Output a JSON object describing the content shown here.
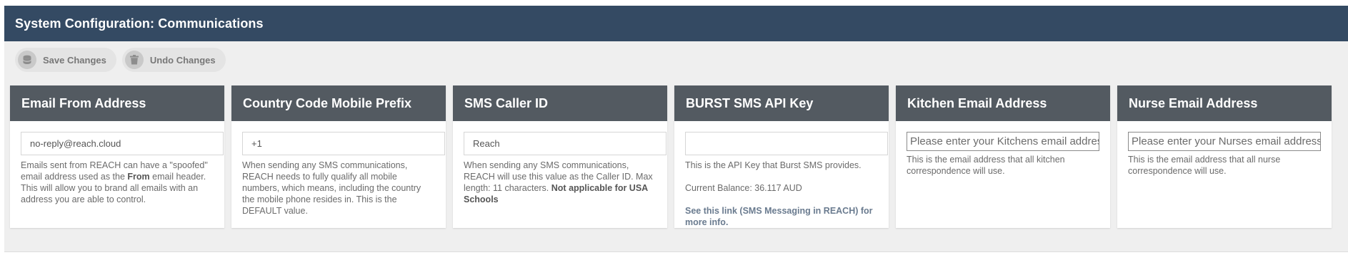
{
  "header": {
    "title": "System Configuration: Communications"
  },
  "toolbar": {
    "save": {
      "label": "Save Changes",
      "icon": "database-icon"
    },
    "undo": {
      "label": "Undo Changes",
      "icon": "trash-icon"
    }
  },
  "colors": {
    "header_bg": "#344a63",
    "card_header_bg": "#535a61",
    "page_bg": "#efefef",
    "link": "#6a7b8f"
  },
  "cards": {
    "email_from": {
      "title": "Email From Address",
      "value": "no-reply@reach.cloud",
      "help_1": "Emails sent from REACH can have a \"spoofed\" email address used as the ",
      "help_bold": "From",
      "help_2": " email header. This will allow you to brand all emails with an address you are able to control."
    },
    "country_code": {
      "title": "Country Code Mobile Prefix",
      "value": "+1",
      "help": "When sending any SMS communications, REACH needs to fully qualify all mobile numbers, which means, including the country the mobile phone resides in. This is the DEFAULT value."
    },
    "sms_caller": {
      "title": "SMS Caller ID",
      "value": "Reach",
      "help_1": "When sending any SMS communications, REACH will use this value as the Caller ID. Max length: 11 characters. ",
      "help_bold": "Not applicable for USA Schools"
    },
    "burst_api": {
      "title": "BURST SMS API Key",
      "value": "",
      "help": "This is the API Key that Burst SMS provides.",
      "balance": "Current Balance: 36.117 AUD",
      "link": "See this link (SMS Messaging in REACH) for more info."
    },
    "kitchen_email": {
      "title": "Kitchen Email Address",
      "placeholder": "Please enter your Kitchens email address",
      "help": "This is the email address that all kitchen correspondence will use."
    },
    "nurse_email": {
      "title": "Nurse Email Address",
      "placeholder": "Please enter your Nurses email address",
      "help": "This is the email address that all nurse correspondence will use."
    }
  }
}
